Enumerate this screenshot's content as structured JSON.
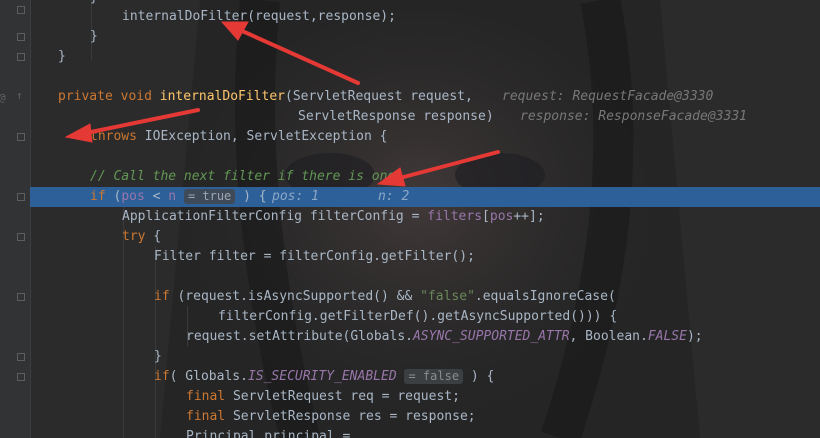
{
  "code": {
    "line1": {
      "text": "internalDoFilter(request,response);"
    },
    "line2": {
      "text": "}"
    },
    "line3": {
      "text": "}"
    },
    "line4": {
      "kw1": "private",
      "kw2": "void",
      "fn": "internalDoFilter",
      "rest": "(ServletRequest request,",
      "hint": "request: RequestFacade@3330"
    },
    "line5": {
      "text": "ServletResponse response)",
      "hint": "response: ResponseFacade@3331"
    },
    "line6": {
      "kw": "throws",
      "rest": " IOException, ServletException {"
    },
    "line7": {
      "text": "// Call the next filter if there is one"
    },
    "line8": {
      "kw": "if",
      "pre": " (",
      "var1": "pos",
      "op": " < ",
      "var2": "n",
      "pill": "= true",
      "post": " ) {",
      "hint1": "pos: 1",
      "hint2": "n: 2"
    },
    "line9": {
      "pre": "ApplicationFilterConfig filterConfig = ",
      "fld1": "filters",
      "mid": "[",
      "fld2": "pos",
      "post": "++];"
    },
    "line10": {
      "kw": "try",
      "post": " {"
    },
    "line11": {
      "text": "Filter filter = filterConfig.getFilter();"
    },
    "line12": {
      "kw": "if",
      "pre": " (request.isAsyncSupported() && ",
      "str": "\"false\"",
      "post": ".equalsIgnoreCase("
    },
    "line13": {
      "text": "filterConfig.getFilterDef().getAsyncSupported())) {"
    },
    "line14": {
      "pre": "request.setAttribute(Globals.",
      "const1": "ASYNC_SUPPORTED_ATTR",
      "mid": ", Boolean.",
      "const2": "FALSE",
      "post": ");"
    },
    "line15": {
      "text": "}"
    },
    "line16": {
      "kw": "if",
      "pre": "( Globals.",
      "const": "IS_SECURITY_ENABLED",
      "pill": "= false",
      "post": " ) {"
    },
    "line17": {
      "kw": "final",
      "rest": " ServletRequest req = request;"
    },
    "line18": {
      "kw": "final",
      "rest": " ServletResponse res = response;"
    },
    "line19": {
      "text": "Principal principal ="
    }
  },
  "colors": {
    "background": "#2b2b2b",
    "highlight": "#2d6099",
    "keyword": "#cc7832",
    "method": "#ffc66d",
    "string": "#6a8759",
    "comment": "#629755",
    "field": "#9876aa",
    "arrow": "#e53935"
  }
}
